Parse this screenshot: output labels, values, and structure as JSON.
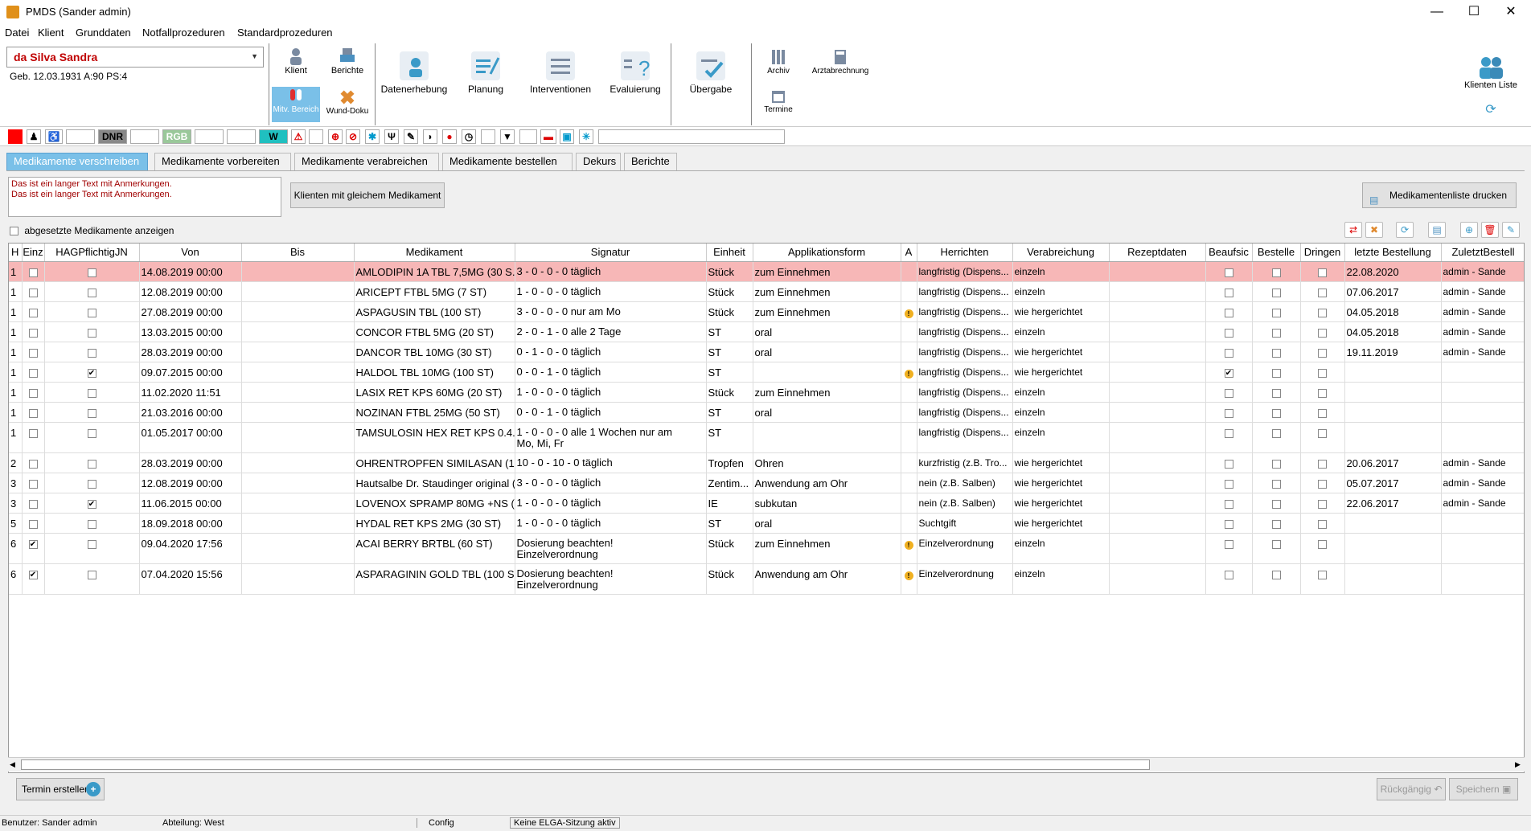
{
  "window": {
    "title": "PMDS (Sander admin)",
    "min": "—",
    "max": "☐",
    "close": "✕"
  },
  "menu": [
    "Datei",
    "Klient",
    "Grunddaten",
    "Notfallprozeduren",
    "Standardprozeduren"
  ],
  "patient": {
    "name": "da Silva Sandra",
    "info": "Geb. 12.03.1931   A:90   PS:4"
  },
  "ribbon": {
    "klient": "Klient",
    "berichte": "Berichte",
    "mitv": "Mitv. Bereich",
    "wunddoku": "Wund-Doku",
    "datenerhebung": "Datenerhebung",
    "planung": "Planung",
    "interventionen": "Interventionen",
    "evaluierung": "Evaluierung",
    "uebergabe": "Übergabe",
    "archiv": "Archiv",
    "arztabrechnung": "Arztabrechnung",
    "termine": "Termine",
    "klienten_liste": "Klienten Liste"
  },
  "status_boxes": {
    "dnr": "DNR",
    "rgb": "RGB",
    "w": "W"
  },
  "tabs": [
    "Medikamente verschreiben",
    "Medikamente vorbereiten",
    "Medikamente verabreichen",
    "Medikamente bestellen",
    "Dekurs",
    "Berichte"
  ],
  "notes": [
    "Das ist ein langer Text mit Anmerkungen.",
    "Das ist ein langer Text mit Anmerkungen."
  ],
  "buttons": {
    "same_med": "Klienten mit gleichem Medikament",
    "print_list": "Medikamentenliste drucken",
    "show_discontinued": "abgesetzte Medikamente anzeigen",
    "termin": "Termin erstellen",
    "undo": "Rückgängig",
    "save": "Speichern"
  },
  "columns": [
    "H",
    "Einz",
    "HAGPflichtigJN",
    "Von",
    "Bis",
    "Medikament",
    "Signatur",
    "Einheit",
    "Applikationsform",
    "A",
    "Herrichten",
    "Verabreichung",
    "Rezeptdaten",
    "Beaufsic",
    "Bestelle",
    "Dringen",
    "letzte Bestellung",
    "ZuletztBestell"
  ],
  "rows": [
    {
      "h": "1",
      "einz": false,
      "hag": false,
      "von": "14.08.2019 00:00",
      "med": "AMLODIPIN 1A TBL  7,5MG (30 S...",
      "sig": "3 - 0 - 0 - 0 täglich",
      "sig2": "",
      "einheit": "Stück",
      "app": "zum Einnehmen",
      "a": false,
      "herr": "langfristig (Dispens...",
      "verab": "einzeln",
      "beauf": false,
      "letzte": "22.08.2020",
      "zuletzt": "admin - Sande"
    },
    {
      "h": "1",
      "einz": false,
      "hag": false,
      "von": "12.08.2019 00:00",
      "med": "ARICEPT FTBL  5MG (7 ST)",
      "sig": "1 - 0 - 0 - 0 täglich",
      "sig2": "",
      "einheit": "Stück",
      "app": "zum Einnehmen",
      "a": false,
      "herr": "langfristig (Dispens...",
      "verab": "einzeln",
      "beauf": false,
      "letzte": "07.06.2017",
      "zuletzt": "admin - Sande"
    },
    {
      "h": "1",
      "einz": false,
      "hag": false,
      "von": "27.08.2019 00:00",
      "med": "ASPAGUSIN TBL (100 ST)",
      "sig": "3 - 0 - 0 - 0 nur am Mo",
      "sig2": "",
      "einheit": "Stück",
      "app": "zum Einnehmen",
      "a": true,
      "herr": "langfristig (Dispens...",
      "verab": "wie hergerichtet",
      "beauf": false,
      "letzte": "04.05.2018",
      "zuletzt": "admin - Sande"
    },
    {
      "h": "1",
      "einz": false,
      "hag": false,
      "von": "13.03.2015 00:00",
      "med": "CONCOR FTBL  5MG (20 ST)",
      "sig": "2 - 0 - 1 - 0 alle 2 Tage",
      "sig2": "",
      "einheit": "ST",
      "app": "oral",
      "a": false,
      "herr": "langfristig (Dispens...",
      "verab": "einzeln",
      "beauf": false,
      "letzte": "04.05.2018",
      "zuletzt": "admin - Sande"
    },
    {
      "h": "1",
      "einz": false,
      "hag": false,
      "von": "28.03.2019 00:00",
      "med": "DANCOR TBL 10MG (30 ST)",
      "sig": "0 - 1 - 0 - 0 täglich",
      "sig2": "",
      "einheit": "ST",
      "app": "oral",
      "a": false,
      "herr": "langfristig (Dispens...",
      "verab": "wie hergerichtet",
      "beauf": false,
      "letzte": "19.11.2019",
      "zuletzt": "admin - Sande"
    },
    {
      "h": "1",
      "einz": false,
      "hag": true,
      "von": "09.07.2015 00:00",
      "med": "HALDOL TBL 10MG (100 ST)",
      "sig": "0 - 0 - 1 - 0 täglich",
      "sig2": "",
      "einheit": "ST",
      "app": "",
      "a": true,
      "herr": "langfristig (Dispens...",
      "verab": "wie hergerichtet",
      "beauf": true,
      "letzte": "",
      "zuletzt": ""
    },
    {
      "h": "1",
      "einz": false,
      "hag": false,
      "von": "11.02.2020 11:51",
      "med": "LASIX RET KPS 60MG (20 ST)",
      "sig": "1 - 0 - 0 - 0 täglich",
      "sig2": "",
      "einheit": "Stück",
      "app": "zum Einnehmen",
      "a": false,
      "herr": "langfristig (Dispens...",
      "verab": "einzeln",
      "beauf": false,
      "letzte": "",
      "zuletzt": ""
    },
    {
      "h": "1",
      "einz": false,
      "hag": false,
      "von": "21.03.2016 00:00",
      "med": "NOZINAN FTBL  25MG (50 ST)",
      "sig": "0 - 0 - 1 - 0 täglich",
      "sig2": "",
      "einheit": "ST",
      "app": "oral",
      "a": false,
      "herr": "langfristig (Dispens...",
      "verab": "einzeln",
      "beauf": false,
      "letzte": "",
      "zuletzt": ""
    },
    {
      "h": "1",
      "einz": false,
      "hag": false,
      "von": "01.05.2017 00:00",
      "med": "TAMSULOSIN HEX RET KPS 0.4...",
      "sig": "1 - 0 - 0 - 0 alle 1 Wochen nur am",
      "sig2": "Mo, Mi, Fr",
      "einheit": "ST",
      "app": "",
      "a": false,
      "herr": "langfristig (Dispens...",
      "verab": "einzeln",
      "beauf": false,
      "letzte": "",
      "zuletzt": ""
    },
    {
      "h": "2",
      "einz": false,
      "hag": false,
      "von": "28.03.2019 00:00",
      "med": "OHRENTROPFEN  SIMILASAN  (1...",
      "sig": "10 - 0 - 10 - 0 täglich",
      "sig2": "",
      "einheit": "Tropfen",
      "app": "Ohren",
      "a": false,
      "herr": "kurzfristig  (z.B. Tro...",
      "verab": "wie hergerichtet",
      "beauf": false,
      "letzte": "20.06.2017",
      "zuletzt": "admin - Sande"
    },
    {
      "h": "3",
      "einz": false,
      "hag": false,
      "von": "12.08.2019 00:00",
      "med": "Hautsalbe Dr. Staudinger original (...",
      "sig": "3 - 0 - 0 - 0 täglich",
      "sig2": "",
      "einheit": "Zentim...",
      "app": "Anwendung am Ohr",
      "a": false,
      "herr": "nein (z.B. Salben)",
      "verab": "wie hergerichtet",
      "beauf": false,
      "letzte": "05.07.2017",
      "zuletzt": "admin - Sande"
    },
    {
      "h": "3",
      "einz": false,
      "hag": true,
      "von": "11.06.2015 00:00",
      "med": "LOVENOX SPRAMP  80MG +NS (...",
      "sig": "1 - 0 - 0 - 0 täglich",
      "sig2": "",
      "einheit": "IE",
      "app": "subkutan",
      "a": false,
      "herr": "nein (z.B. Salben)",
      "verab": "wie hergerichtet",
      "beauf": false,
      "letzte": "22.06.2017",
      "zuletzt": "admin - Sande"
    },
    {
      "h": "5",
      "einz": false,
      "hag": false,
      "von": "18.09.2018 00:00",
      "med": "HYDAL RET KPS  2MG (30 ST)",
      "sig": "1 - 0 - 0 - 0 täglich",
      "sig2": "",
      "einheit": "ST",
      "app": "oral",
      "a": false,
      "herr": "Suchtgift",
      "verab": "wie hergerichtet",
      "beauf": false,
      "letzte": "",
      "zuletzt": ""
    },
    {
      "h": "6",
      "einz": true,
      "hag": false,
      "von": "09.04.2020 17:56",
      "med": "ACAI BERRY BRTBL (60 ST)",
      "sig": "Dosierung beachten!",
      "sig2": "Einzelverordnung",
      "einheit": "Stück",
      "app": "zum Einnehmen",
      "a": true,
      "herr": "Einzelverordnung",
      "verab": "einzeln",
      "beauf": false,
      "letzte": "",
      "zuletzt": ""
    },
    {
      "h": "6",
      "einz": true,
      "hag": false,
      "von": "07.04.2020 15:56",
      "med": "ASPARAGININ GOLD TBL (100 S...",
      "sig": "Dosierung beachten!",
      "sig2": "Einzelverordnung",
      "einheit": "Stück",
      "app": "Anwendung am Ohr",
      "a": true,
      "herr": "Einzelverordnung",
      "verab": "einzeln",
      "beauf": false,
      "letzte": "",
      "zuletzt": ""
    }
  ],
  "statusbar": {
    "user": "Benutzer: Sander admin",
    "dept": "Abteilung: West",
    "config": "Config",
    "elga": "Keine ELGA-Sitzung aktiv"
  }
}
